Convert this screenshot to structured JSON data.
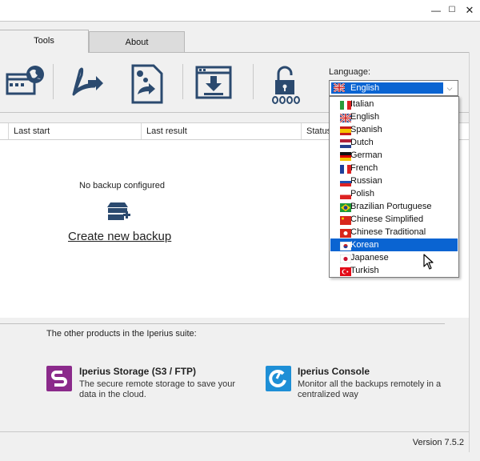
{
  "window": {
    "min_glyph": "—",
    "max_glyph": "☐",
    "close_glyph": "✕"
  },
  "tabs": [
    {
      "label": "Tools",
      "active": true
    },
    {
      "label": "About",
      "active": false
    }
  ],
  "toolbar": {
    "icons": [
      "web-browser-icon",
      "pdf-export-icon",
      "file-settings-icon",
      "download-window-icon",
      "padlock-password-icon"
    ],
    "language_label": "Language:",
    "language_selected": "English"
  },
  "table": {
    "columns": [
      "Last start",
      "Last result",
      "Status"
    ]
  },
  "main": {
    "empty_text": "No backup configured",
    "create_link": "Create new backup"
  },
  "suite": {
    "title": "The other products in the Iperius suite:",
    "products": [
      {
        "name": "Iperius Storage (S3 / FTP)",
        "desc_line1": "The secure remote storage to save your",
        "desc_line2": "data in the cloud.",
        "icon": "iperius-storage-icon",
        "color": "#8b2a8b"
      },
      {
        "name": "Iperius Console",
        "desc_line1": "Monitor all the backups remotely in a",
        "desc_line2": "centralized way",
        "icon": "iperius-console-icon",
        "color": "#1e8fd6"
      }
    ]
  },
  "status": {
    "version": "Version 7.5.2"
  },
  "dropdown": {
    "highlighted_index": 11,
    "options": [
      "Italian",
      "English",
      "Spanish",
      "Dutch",
      "German",
      "French",
      "Russian",
      "Polish",
      "Brazilian Portuguese",
      "Chinese Simplified",
      "Chinese Traditional",
      "Korean",
      "Japanese",
      "Turkish"
    ]
  },
  "colors": {
    "accent": "#0a64d2",
    "icon_navy": "#2b4a6f"
  }
}
